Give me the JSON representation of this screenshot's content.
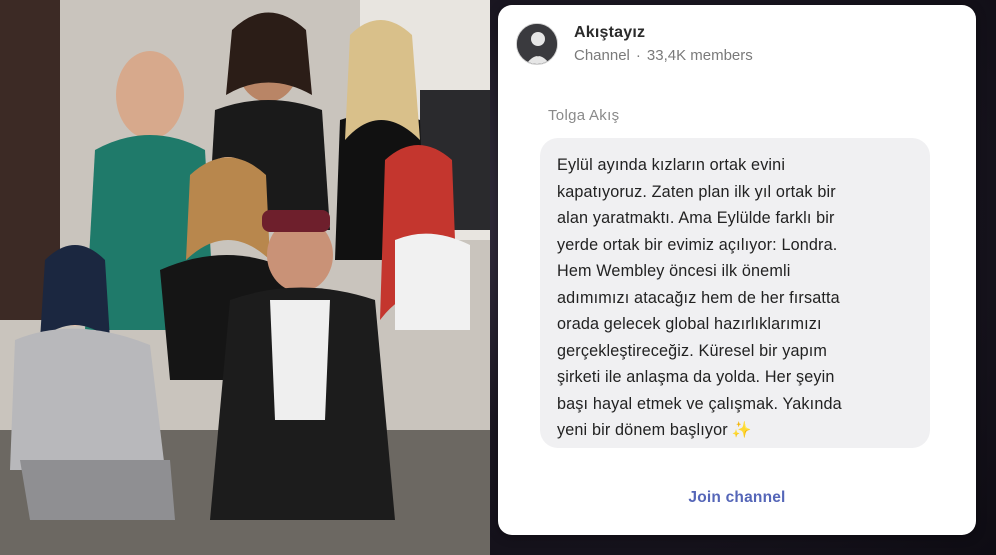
{
  "channel": {
    "name": "Akıştayız",
    "type": "Channel",
    "separator": "·",
    "members": "33,4K members",
    "avatar_icon": "avatar-portrait"
  },
  "post": {
    "sender": "Tolga Akış",
    "lines": [
      "Eylül ayında kızların ortak evini",
      "kapatıyoruz. Zaten plan ilk yıl ortak bir",
      "alan yaratmaktı. Ama Eylülde farklı bir",
      "yerde ortak bir evimiz açılıyor: Londra.",
      "Hem Wembley öncesi ilk önemli",
      "adımımızı atacağız hem de her fırsatta",
      "orada gelecek global hazırlıklarımızı",
      "gerçekleştireceğiz. Küresel bir yapım",
      "şirketi ile anlaşma da yolda. Her şeyin",
      "başı hayal etmek ve çalışmak. Yakında",
      "yeni bir dönem başlıyor"
    ],
    "emoji": "✨"
  },
  "actions": {
    "join_label": "Join channel"
  },
  "colors": {
    "accent": "#5566b8",
    "bubble": "#f0f0f2",
    "backdrop": "#1b1722"
  }
}
